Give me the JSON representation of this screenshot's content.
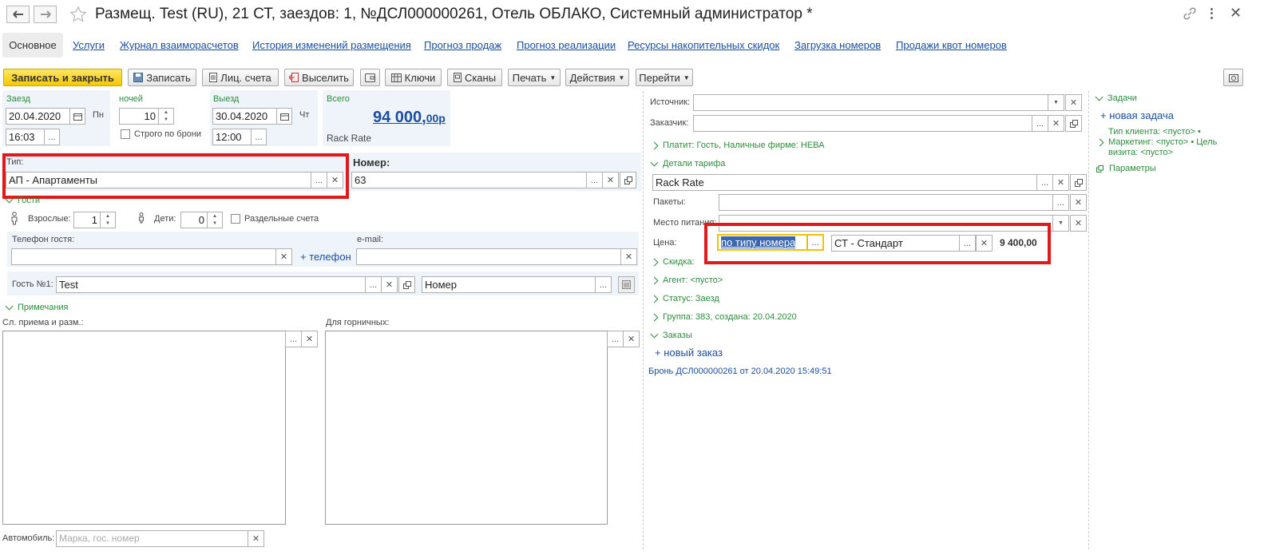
{
  "window": {
    "title": "Размещ. Test (RU), 21 СТ, заездов: 1, №ДСЛ000000261, Отель ОБЛАКО, Системный администратор *"
  },
  "tabs": [
    {
      "label": "Основное",
      "active": true
    },
    {
      "label": "Услуги"
    },
    {
      "label": "Журнал взаиморасчетов"
    },
    {
      "label": "История изменений размещения"
    },
    {
      "label": "Прогноз продаж"
    },
    {
      "label": "Прогноз реализации"
    },
    {
      "label": "Ресурсы накопительных скидок"
    },
    {
      "label": "Загрузка номеров"
    },
    {
      "label": "Продажи квот номеров"
    }
  ],
  "toolbar": {
    "save_close": "Записать и закрыть",
    "save": "Записать",
    "accounts": "Лиц. счета",
    "checkout": "Выселить",
    "keys": "Ключи",
    "scans": "Сканы",
    "print": "Печать",
    "actions": "Действия",
    "goto": "Перейти"
  },
  "stay": {
    "checkin_label": "Заезд",
    "checkin_date": "20.04.2020",
    "checkin_dow": "Пн",
    "checkin_time": "16:03",
    "nights_label": "ночей",
    "nights": "10",
    "strict_label": "Строго по брони",
    "checkout_label": "Выезд",
    "checkout_date": "30.04.2020",
    "checkout_dow": "Чт",
    "checkout_time": "12:00",
    "total_label": "Всего",
    "total_main": "94 000,",
    "total_cents": "00р",
    "rate_name": "Rack Rate"
  },
  "room": {
    "type_label": "Тип:",
    "type_value": "АП - Апартаменты",
    "number_label": "Номер:",
    "number_value": "63"
  },
  "guests": {
    "section": "Гости",
    "adults_label": "Взрослые:",
    "adults": "1",
    "children_label": "Дети:",
    "children": "0",
    "separate_label": "Раздельные счета",
    "phone_label": "Телефон гостя:",
    "add_phone": "+ телефон",
    "email_label": "e-mail:",
    "guest_label": "Гость №1:",
    "guest_value": "Test",
    "room_placeholder_value": "Номер"
  },
  "notes": {
    "section": "Примечания",
    "reception_label": "Сл. приема и разм.:",
    "maids_label": "Для горничных:"
  },
  "car": {
    "label": "Автомобиль:",
    "placeholder": "Марка, гос. номер"
  },
  "right": {
    "source_label": "Источник:",
    "customer_label": "Заказчик:",
    "payer": "Платит: Гость, Наличные фирме: НЕВА",
    "tariff_section": "Детали тарифа",
    "tariff_value": "Rack Rate",
    "packages_label": "Пакеты:",
    "meal_label": "Место питания:",
    "price_label": "Цена:",
    "price_mode": "по типу номера",
    "price_category": "СТ - Стандарт",
    "price_value": "9 400,00",
    "discount": "Скидка:",
    "agent": "Агент: <пусто>",
    "status": "Статус: Заезд",
    "group": "Группа: 383, создана: 20.04.2020",
    "orders": "Заказы",
    "new_order": "+ новый заказ",
    "booking": "Бронь ДСЛ000000261 от 20.04.2020 15:49:51"
  },
  "side": {
    "tasks": "Задачи",
    "new_task": "+ новая задача",
    "client_info": "Тип клиента: <пусто> •",
    "marketing": "Маркетинг: <пусто> • Цель визита: <пусто>",
    "params": "Параметры"
  },
  "colors": {
    "accent_green": "#2d8d3c",
    "link_blue": "#1c4fa0",
    "highlight_red": "#e01a1a",
    "primary_yellow": "#f5c800"
  }
}
